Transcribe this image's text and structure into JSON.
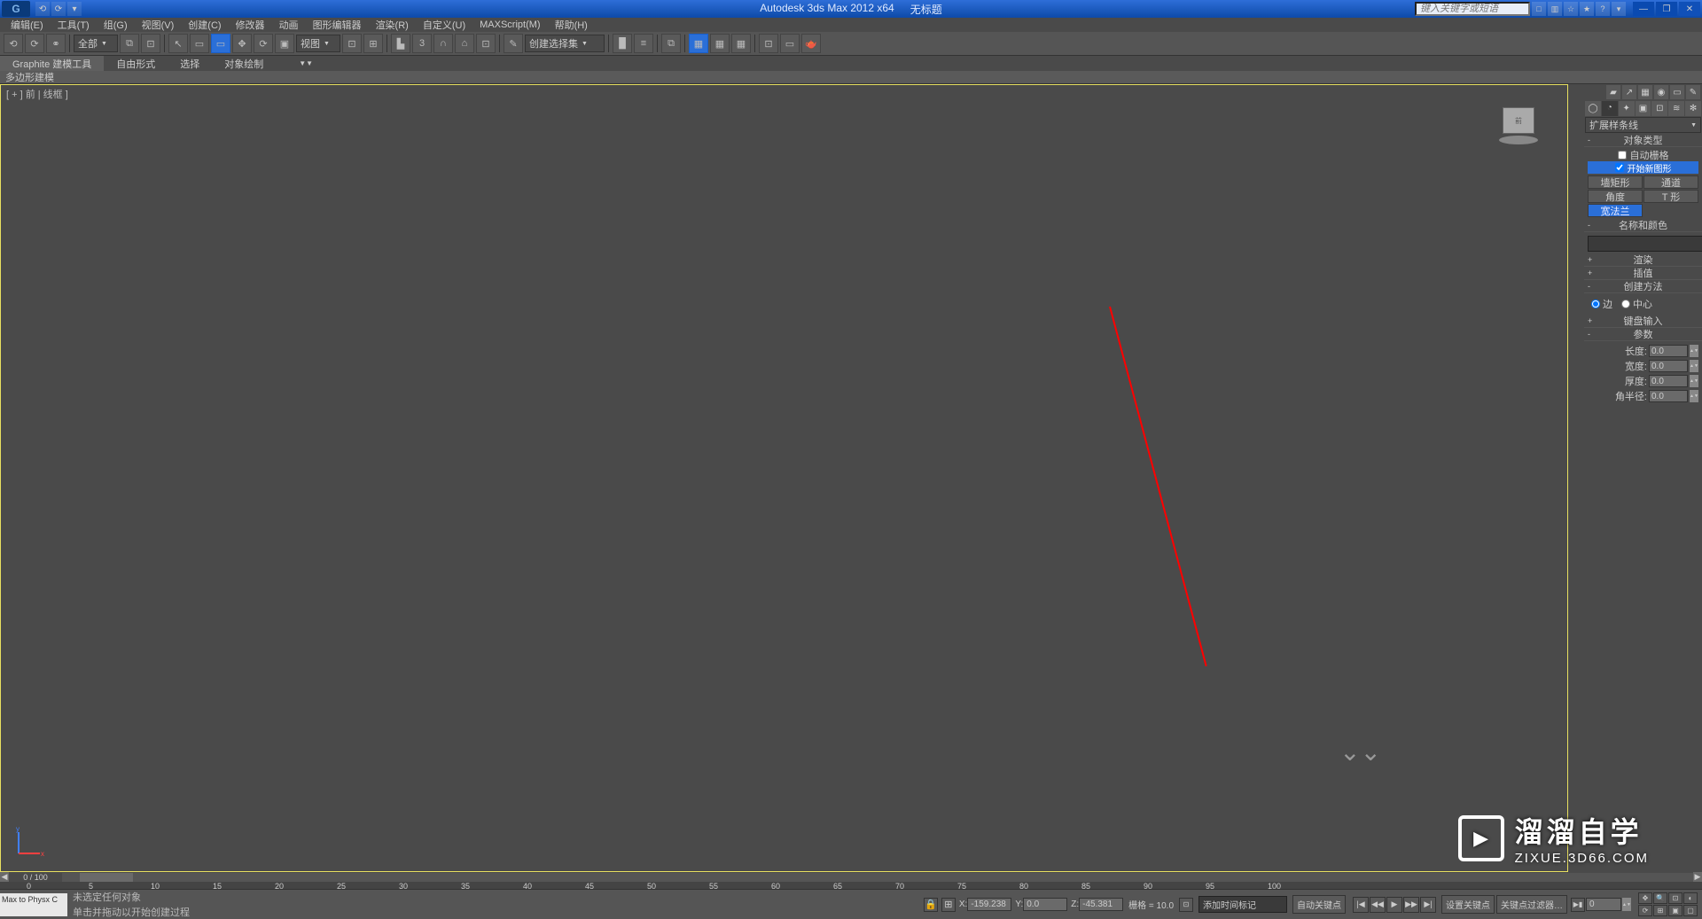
{
  "app": {
    "title": "Autodesk 3ds Max  2012 x64",
    "doc_title": "无标题"
  },
  "qat": [
    "⟲",
    "⟳",
    "▾"
  ],
  "search": {
    "placeholder": "键入关键字或短语"
  },
  "title_icons": [
    "□",
    "▥",
    "☆",
    "★",
    "?",
    "▾",
    "—",
    "❐",
    "✕"
  ],
  "menu": [
    "编辑(E)",
    "工具(T)",
    "组(G)",
    "视图(V)",
    "创建(C)",
    "修改器",
    "动画",
    "图形编辑器",
    "渲染(R)",
    "自定义(U)",
    "MAXScript(M)",
    "帮助(H)"
  ],
  "toolbar": {
    "set_dropdown": "全部",
    "view_dropdown": "视图",
    "named_sel": "创建选择集"
  },
  "ribbon": {
    "tabs": [
      "Graphite 建模工具",
      "自由形式",
      "选择",
      "对象绘制"
    ],
    "subpanel": "多边形建模"
  },
  "viewport": {
    "label": "[ + ] 前 | 线框 ]"
  },
  "panel": {
    "dropdown": "扩展样条线",
    "rollout_objtype": "对象类型",
    "auto_grid": "自动栅格",
    "start_new": "开始新图形",
    "buttons": [
      [
        "墙矩形",
        "通道"
      ],
      [
        "角度",
        "T 形"
      ],
      [
        "宽法兰",
        ""
      ]
    ],
    "selected_button": "宽法兰",
    "rollout_name": "名称和颜色",
    "rollout_render": "渲染",
    "rollout_interp": "插值",
    "rollout_method": "创建方法",
    "method_opts": [
      "边",
      "中心"
    ],
    "rollout_keyin": "键盘输入",
    "rollout_params": "参数",
    "params": [
      {
        "label": "长度:",
        "val": "0.0"
      },
      {
        "label": "宽度:",
        "val": "0.0"
      },
      {
        "label": "厚度:",
        "val": "0.0"
      },
      {
        "label": "角半径:",
        "val": "0.0"
      }
    ]
  },
  "timeline": {
    "frame_label": "0 / 100",
    "ticks": [
      "0",
      "5",
      "10",
      "15",
      "20",
      "25",
      "30",
      "35",
      "40",
      "45",
      "50",
      "55",
      "60",
      "65",
      "70",
      "75",
      "80",
      "85",
      "90",
      "95",
      "100"
    ]
  },
  "status": {
    "maxscript": "Max to Physx C",
    "msg1": "未选定任何对象",
    "msg2": "单击并拖动以开始创建过程",
    "coords": {
      "x": "-159.238",
      "y": "0.0",
      "z": "-45.381"
    },
    "grid": "栅格 = 10.0",
    "add_time": "添加时间标记",
    "auto_key": "自动关键点",
    "set_key": "设置关键点",
    "key_filter": "关键点过滤器…",
    "frame_spinner": "0"
  },
  "watermark": {
    "main": "溜溜自学",
    "url": "ZIXUE.3D66.COM"
  }
}
